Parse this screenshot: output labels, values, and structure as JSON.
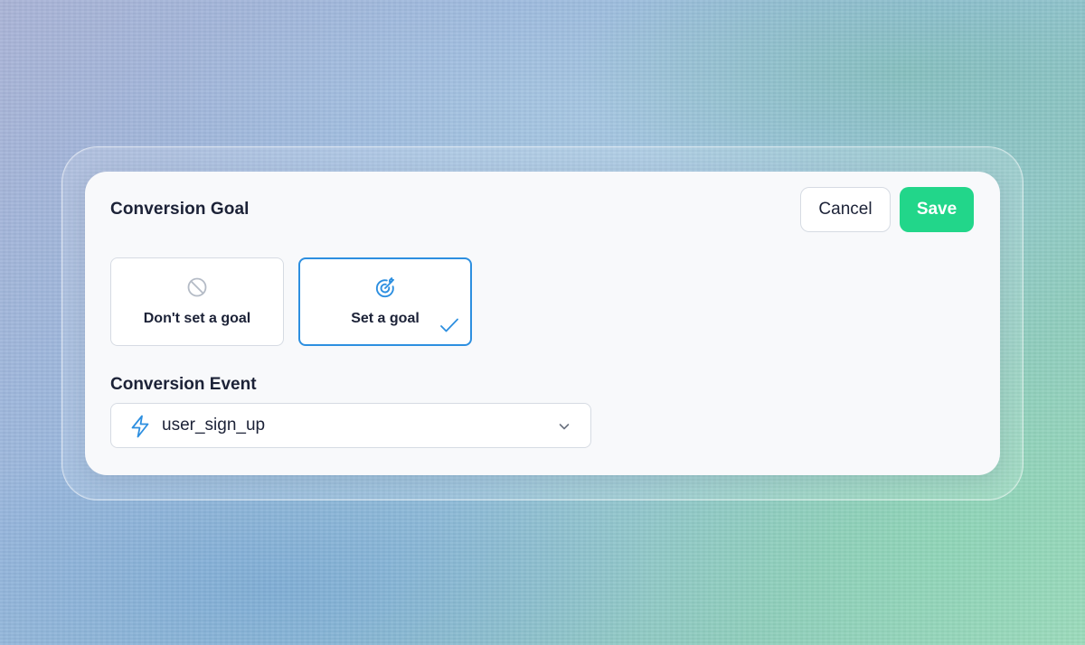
{
  "dialog": {
    "title": "Conversion Goal",
    "cancel_label": "Cancel",
    "save_label": "Save"
  },
  "goal_options": [
    {
      "label": "Don't set a goal",
      "icon": "ban-icon",
      "selected": false
    },
    {
      "label": "Set a goal",
      "icon": "target-icon",
      "selected": true
    }
  ],
  "conversion_event": {
    "label": "Conversion Event",
    "value": "user_sign_up",
    "icon": "lightning-bolt-icon"
  },
  "colors": {
    "accent": "#2d8fe0",
    "save_button": "#22d68a",
    "text": "#1c2237",
    "border": "#d6dbe3"
  }
}
